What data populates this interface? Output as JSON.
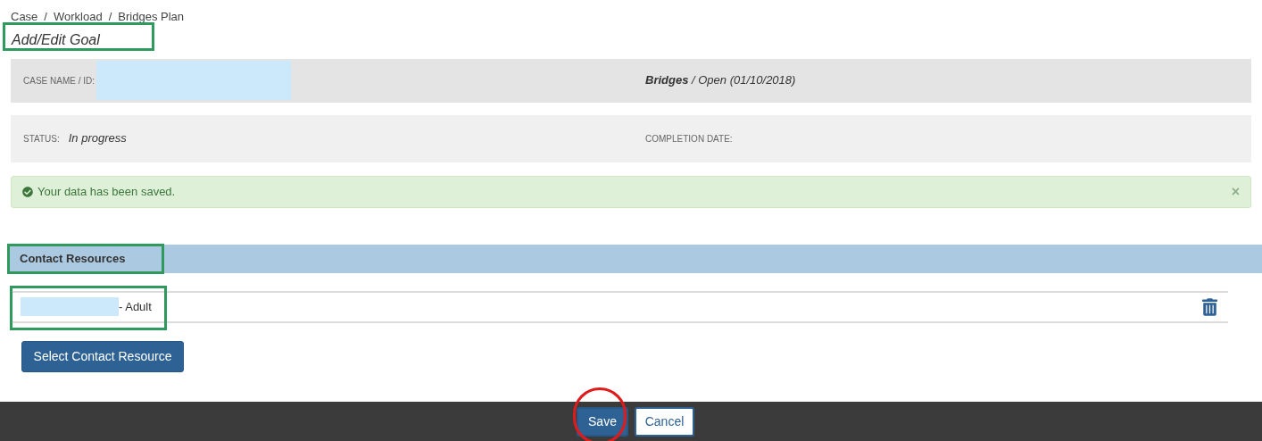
{
  "breadcrumb": [
    {
      "label": "Case"
    },
    {
      "label": "Workload"
    },
    {
      "label": "Bridges Plan"
    }
  ],
  "breadcrumb_separator": "/",
  "page_title": {
    "text": "Add/Edit Goal",
    "highlighted": true
  },
  "case_panel": {
    "label": "CASE NAME / ID:",
    "redacted": true,
    "program": "**Bridges** / Open (01/10/2018)"
  },
  "status_panel": {
    "status_label": "STATUS:",
    "status_value": "In progress",
    "completion_label": "COMPLETION DATE:"
  },
  "alert": {
    "message": "Your data has been saved.",
    "close": "×"
  },
  "section": {
    "title": "Contact Resources",
    "highlighted": true
  },
  "contacts": [
    {
      "redacted": true,
      "suffix": "- Adult",
      "highlighted": true
    }
  ],
  "select_button": "Select Contact Resource",
  "footer_buttons": [
    {
      "label": "Save",
      "kind": "primary",
      "circled": true
    },
    {
      "label": "Cancel",
      "kind": "secondary",
      "circled": false
    }
  ]
}
